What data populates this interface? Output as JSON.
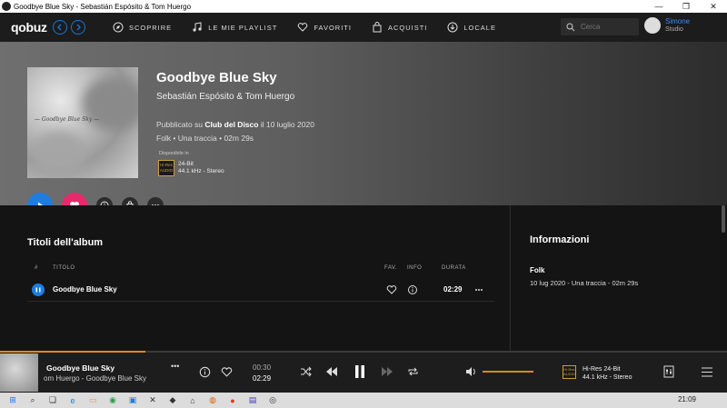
{
  "window": {
    "title": "Goodbye Blue Sky - Sebastián Espósito & Tom Huergo"
  },
  "app": {
    "logo": "qobuz"
  },
  "nav": {
    "items": [
      {
        "label": "SCOPRIRE",
        "icon": "compass-icon"
      },
      {
        "label": "LE MIE PLAYLIST",
        "icon": "music-note-icon"
      },
      {
        "label": "FAVORITI",
        "icon": "heart-icon"
      },
      {
        "label": "ACQUISTI",
        "icon": "bag-icon"
      },
      {
        "label": "LOCALE",
        "icon": "download-icon"
      }
    ]
  },
  "search": {
    "placeholder": "Cerca"
  },
  "user": {
    "name": "Simone",
    "plan": "Studio"
  },
  "album": {
    "title": "Goodbye Blue Sky",
    "artist": "Sebastián Espósito & Tom Huergo",
    "published_prefix": "Pubblicato su",
    "label": "Club del Disco",
    "published_suffix": "il 10 luglio 2020",
    "meta": "Folk • Una traccia • 02m 29s",
    "available_in": "Disponibile in",
    "hires_badge": "Hi-Res AUDIO",
    "quality_line1": "24-Bit",
    "quality_line2": "44.1 kHz - Stereo",
    "cover_text": "— Goodbye Blue Sky —"
  },
  "tracks": {
    "section_title": "Titoli dell'album",
    "headers": {
      "num": "#",
      "title": "TITOLO",
      "fav": "FAV.",
      "info": "INFO",
      "duration": "DURATA"
    },
    "rows": [
      {
        "title": "Goodbye Blue Sky",
        "duration": "02:29"
      }
    ]
  },
  "info_panel": {
    "title": "Informazioni",
    "genre": "Folk",
    "detail": "10 lug 2020 - Una traccia - 02m 29s"
  },
  "player": {
    "title": "Goodbye Blue Sky",
    "subtitle": "om Huergo - Goodbye Blue Sky",
    "elapsed": "00:30",
    "total": "02:29",
    "progress": 0.2,
    "volume": 0.7,
    "hires_badge": "Hi-Res AUDIO",
    "quality_line1": "Hi-Res 24-Bit",
    "quality_line2": "44.1 kHz - Stereo",
    "more": "•••"
  },
  "taskbar": {
    "time": "21:09"
  },
  "colors": {
    "accent_blue": "#1e7ddf",
    "fav_pink": "#e62a6b",
    "progress_orange": "#d98c0a",
    "hires_gold": "#c8a236"
  }
}
